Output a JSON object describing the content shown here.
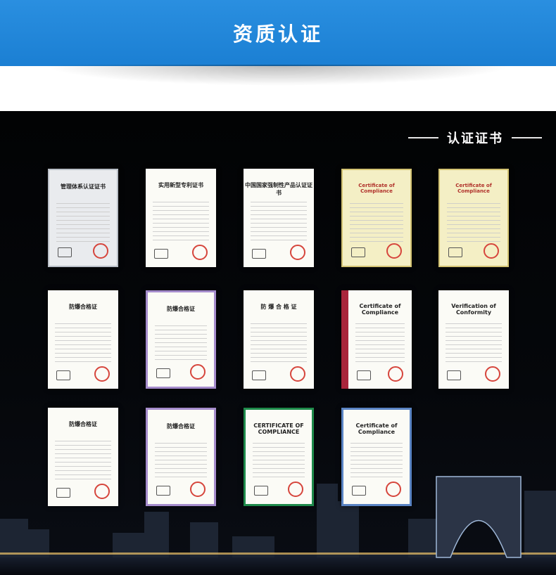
{
  "banner": {
    "title": "资质认证"
  },
  "section": {
    "heading": "认证证书"
  },
  "certificates": [
    {
      "title": "管理体系认证证书",
      "style": "grey"
    },
    {
      "title": "实用新型专利证书",
      "style": "plain"
    },
    {
      "title": "中国国家强制性产品认证证书",
      "style": "plain"
    },
    {
      "title": "Certificate of Compliance",
      "style": "yellow"
    },
    {
      "title": "Certificate of Compliance",
      "style": "yellow"
    },
    {
      "title": "防爆合格证",
      "style": "plain"
    },
    {
      "title": "防爆合格证",
      "style": "purple"
    },
    {
      "title": "防 爆 合 格 证",
      "style": "plain"
    },
    {
      "title": "Certificate of Compliance",
      "style": "red-side"
    },
    {
      "title": "Verification of Conformity",
      "style": "plain"
    },
    {
      "title": "防爆合格证",
      "style": "plain"
    },
    {
      "title": "防爆合格证",
      "style": "purple"
    },
    {
      "title": "CERTIFICATE OF COMPLIANCE",
      "style": "green"
    },
    {
      "title": "Certificate of Compliance",
      "style": "blue"
    }
  ]
}
